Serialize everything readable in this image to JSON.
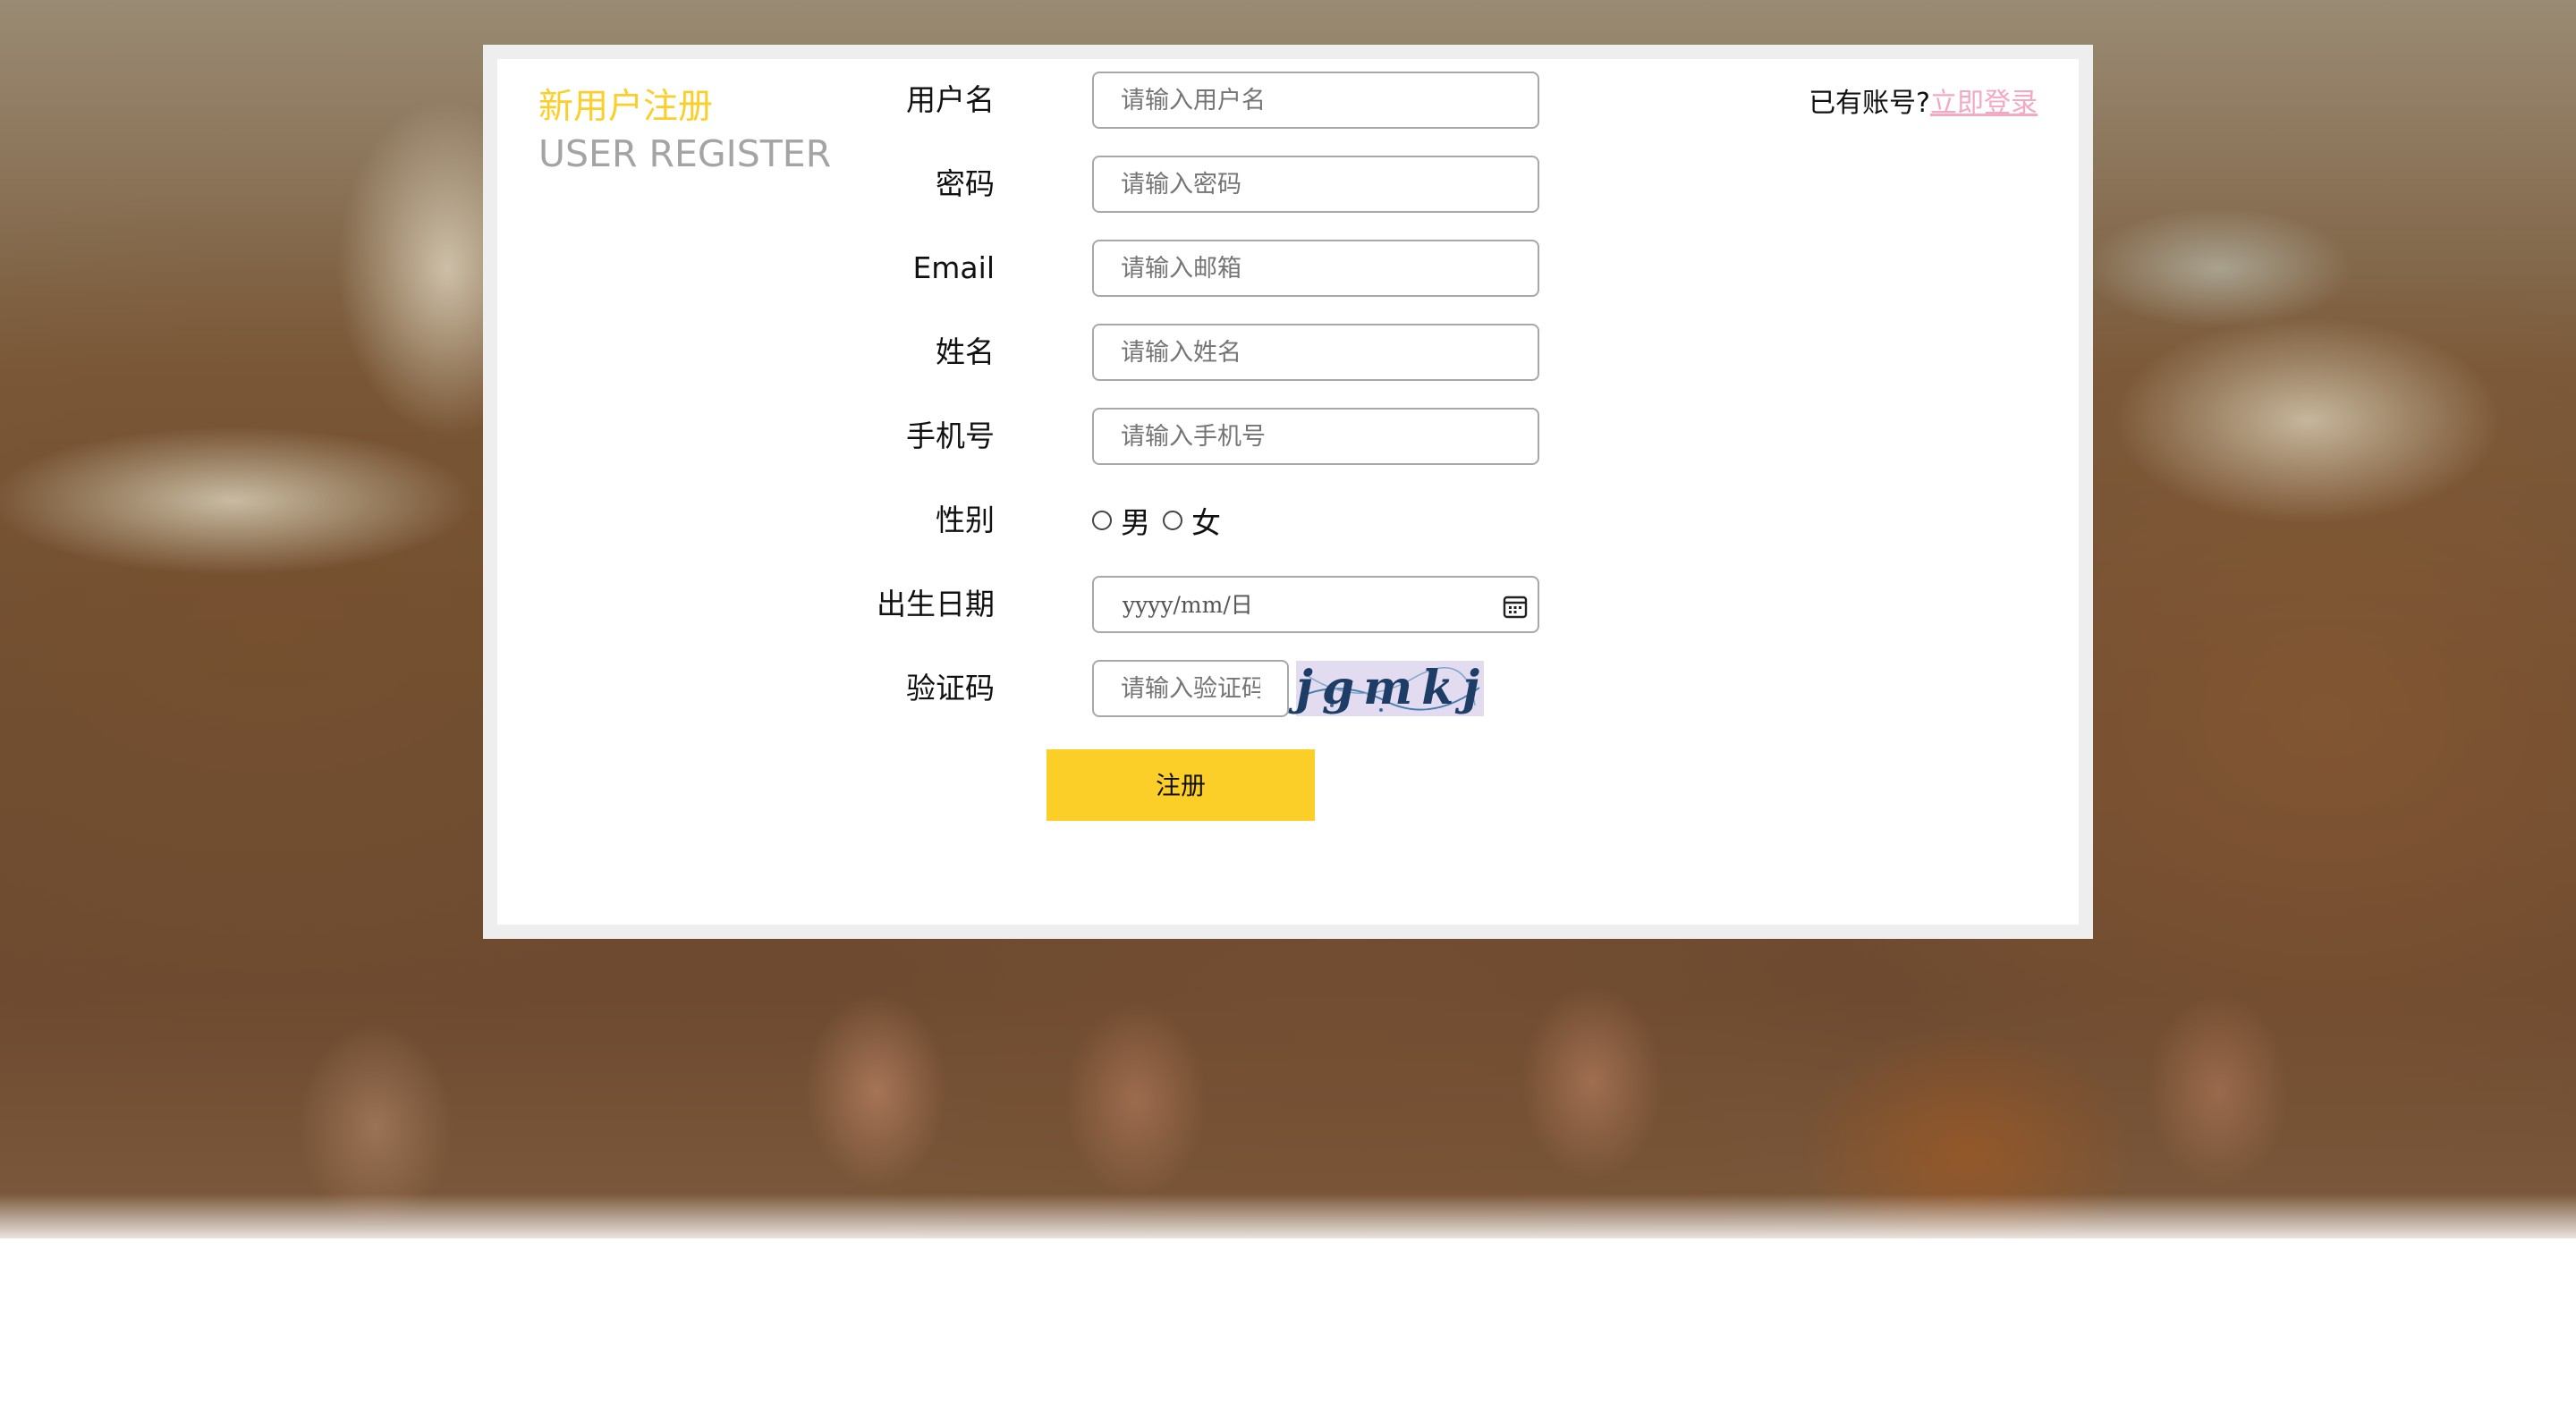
{
  "header": {
    "title_cn": "新用户注册",
    "title_en": "USER REGISTER",
    "login_prompt": "已有账号?",
    "login_link": "立即登录"
  },
  "form": {
    "username": {
      "label": "用户名",
      "placeholder": "请输入用户名"
    },
    "password": {
      "label": "密码",
      "placeholder": "请输入密码"
    },
    "email": {
      "label": "Email",
      "placeholder": "请输入邮箱"
    },
    "name": {
      "label": "姓名",
      "placeholder": "请输入姓名"
    },
    "phone": {
      "label": "手机号",
      "placeholder": "请输入手机号"
    },
    "gender": {
      "label": "性别",
      "options": [
        "男",
        "女"
      ]
    },
    "birthdate": {
      "label": "出生日期",
      "placeholder": "yyyy/mm/日",
      "icon": "calendar-icon"
    },
    "captcha": {
      "label": "验证码",
      "placeholder": "请输入验证码",
      "image_text": "jgmkj"
    },
    "submit_label": "注册"
  },
  "colors": {
    "accent": "#fbcf28",
    "title_en": "#a4a4a4",
    "login_link": "#f3a9c0",
    "panel_border": "#eeeeee",
    "captcha_bg": "#e3dcf1"
  }
}
